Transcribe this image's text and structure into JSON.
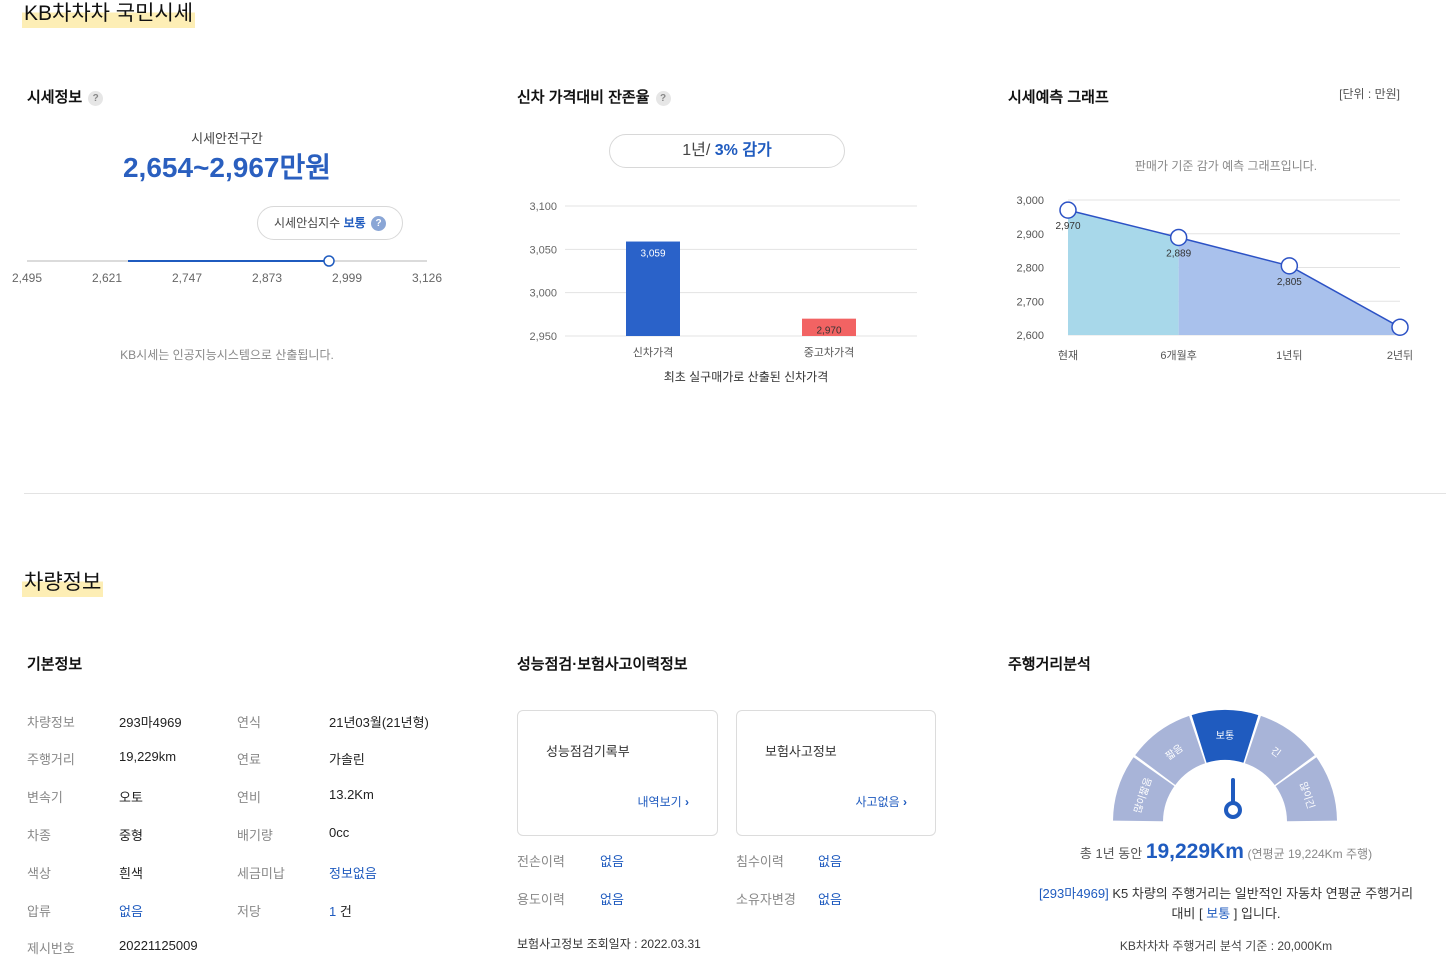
{
  "market": {
    "section_title": "KB차차차 국민시세",
    "price_info": {
      "title": "시세정보",
      "help": "?",
      "safe_range_label": "시세안전구간",
      "safe_range_value": "2,654~2,967만원",
      "trust_label": "시세안심지수",
      "trust_value": "보통",
      "scale_ticks": [
        "2,495",
        "2,621",
        "2,747",
        "2,873",
        "2,999",
        "3,126"
      ],
      "note": "KB시세는 인공지능시스템으로 산출됩니다."
    },
    "residual": {
      "title": "신차 가격대비 잔존율",
      "help": "?",
      "period": "1년/",
      "decrease": "3% 감가",
      "caption": "최초 실구매가로 산출된 신차가격"
    },
    "forecast": {
      "title": "시세예측 그래프",
      "unit": "[단위 : 만원]",
      "subtitle": "판매가 기준 감가 예측 그래프입니다."
    }
  },
  "chart_data": [
    {
      "type": "bar",
      "categories": [
        "신차가격",
        "중고차가격"
      ],
      "values": [
        3059,
        2970
      ],
      "data_labels": [
        "3,059",
        "2,970"
      ],
      "ylim": [
        2950,
        3100
      ],
      "yticks": [
        "2,950",
        "3,000",
        "3,050",
        "3,100"
      ],
      "colors": [
        "#2a62c9",
        "#f26363"
      ],
      "grid": true,
      "title": "",
      "xlabel": "최초 실구매가로 산출된 신차가격",
      "ylabel": ""
    },
    {
      "type": "area",
      "categories": [
        "현재",
        "6개월후",
        "1년뒤",
        "2년뒤"
      ],
      "values": [
        2970,
        2889,
        2805,
        2623
      ],
      "data_labels": [
        "2,970",
        "2,889",
        "2,805",
        ""
      ],
      "ylim": [
        2600,
        3000
      ],
      "yticks": [
        "2,600",
        "2,700",
        "2,800",
        "2,900",
        "3,000"
      ],
      "colors": [
        "#a8d8ea",
        "#a9c1ec",
        "#2c52c5"
      ],
      "grid": true,
      "title": "",
      "xlabel": "",
      "ylabel": ""
    }
  ],
  "vehicle": {
    "section_title": "차량정보",
    "basic": {
      "title": "기본정보",
      "rows": [
        {
          "l1": "차량정보",
          "v1": "293마4969",
          "l2": "연식",
          "v2": "21년03월(21년형)"
        },
        {
          "l1": "주행거리",
          "v1": "19,229km",
          "l2": "연료",
          "v2": "가솔린"
        },
        {
          "l1": "변속기",
          "v1": "오토",
          "l2": "연비",
          "v2": "13.2Km"
        },
        {
          "l1": "차종",
          "v1": "중형",
          "l2": "배기량",
          "v2": "0cc"
        },
        {
          "l1": "색상",
          "v1": "흰색",
          "l2": "세금미납",
          "v2": "정보없음"
        },
        {
          "l1": "압류",
          "v1": "없음",
          "l2": "저당",
          "v2": "1",
          "v2_suffix": "건"
        },
        {
          "l1": "제시번호",
          "v1": "20221125009"
        }
      ]
    },
    "inspection": {
      "title": "성능점검·보험사고이력정보",
      "box1_title": "성능점검기록부",
      "box1_link": "내역보기",
      "box2_title": "보험사고정보",
      "box2_link": "사고없음",
      "items": [
        {
          "label": "전손이력",
          "value": "없음"
        },
        {
          "label": "침수이력",
          "value": "없음"
        },
        {
          "label": "용도이력",
          "value": "없음"
        },
        {
          "label": "소유자변경",
          "value": "없음"
        }
      ],
      "lookup_date": "보험사고정보 조회일자 : 2022.03.31"
    },
    "mileage": {
      "title": "주행거리분석",
      "gauge_labels": [
        "많이짧음",
        "짧음",
        "보통",
        "긴",
        "많이긴"
      ],
      "active": "보통",
      "active_index": 2,
      "total_prefix": "총 1년 동안",
      "total_value": "19,229Km",
      "total_suffix": "(연평균 19,224Km 주행)",
      "desc_plate": "[293마4969]",
      "desc_text": "K5 차량의 주행거리는 일반적인 자동차 연평균 주행거리",
      "desc_line2_prefix": "대비 [",
      "desc_line2_value": "보통",
      "desc_line2_suffix": "] 입니다.",
      "basis": "KB차차차 주행거리 분석 기준 : 20,000Km"
    }
  }
}
